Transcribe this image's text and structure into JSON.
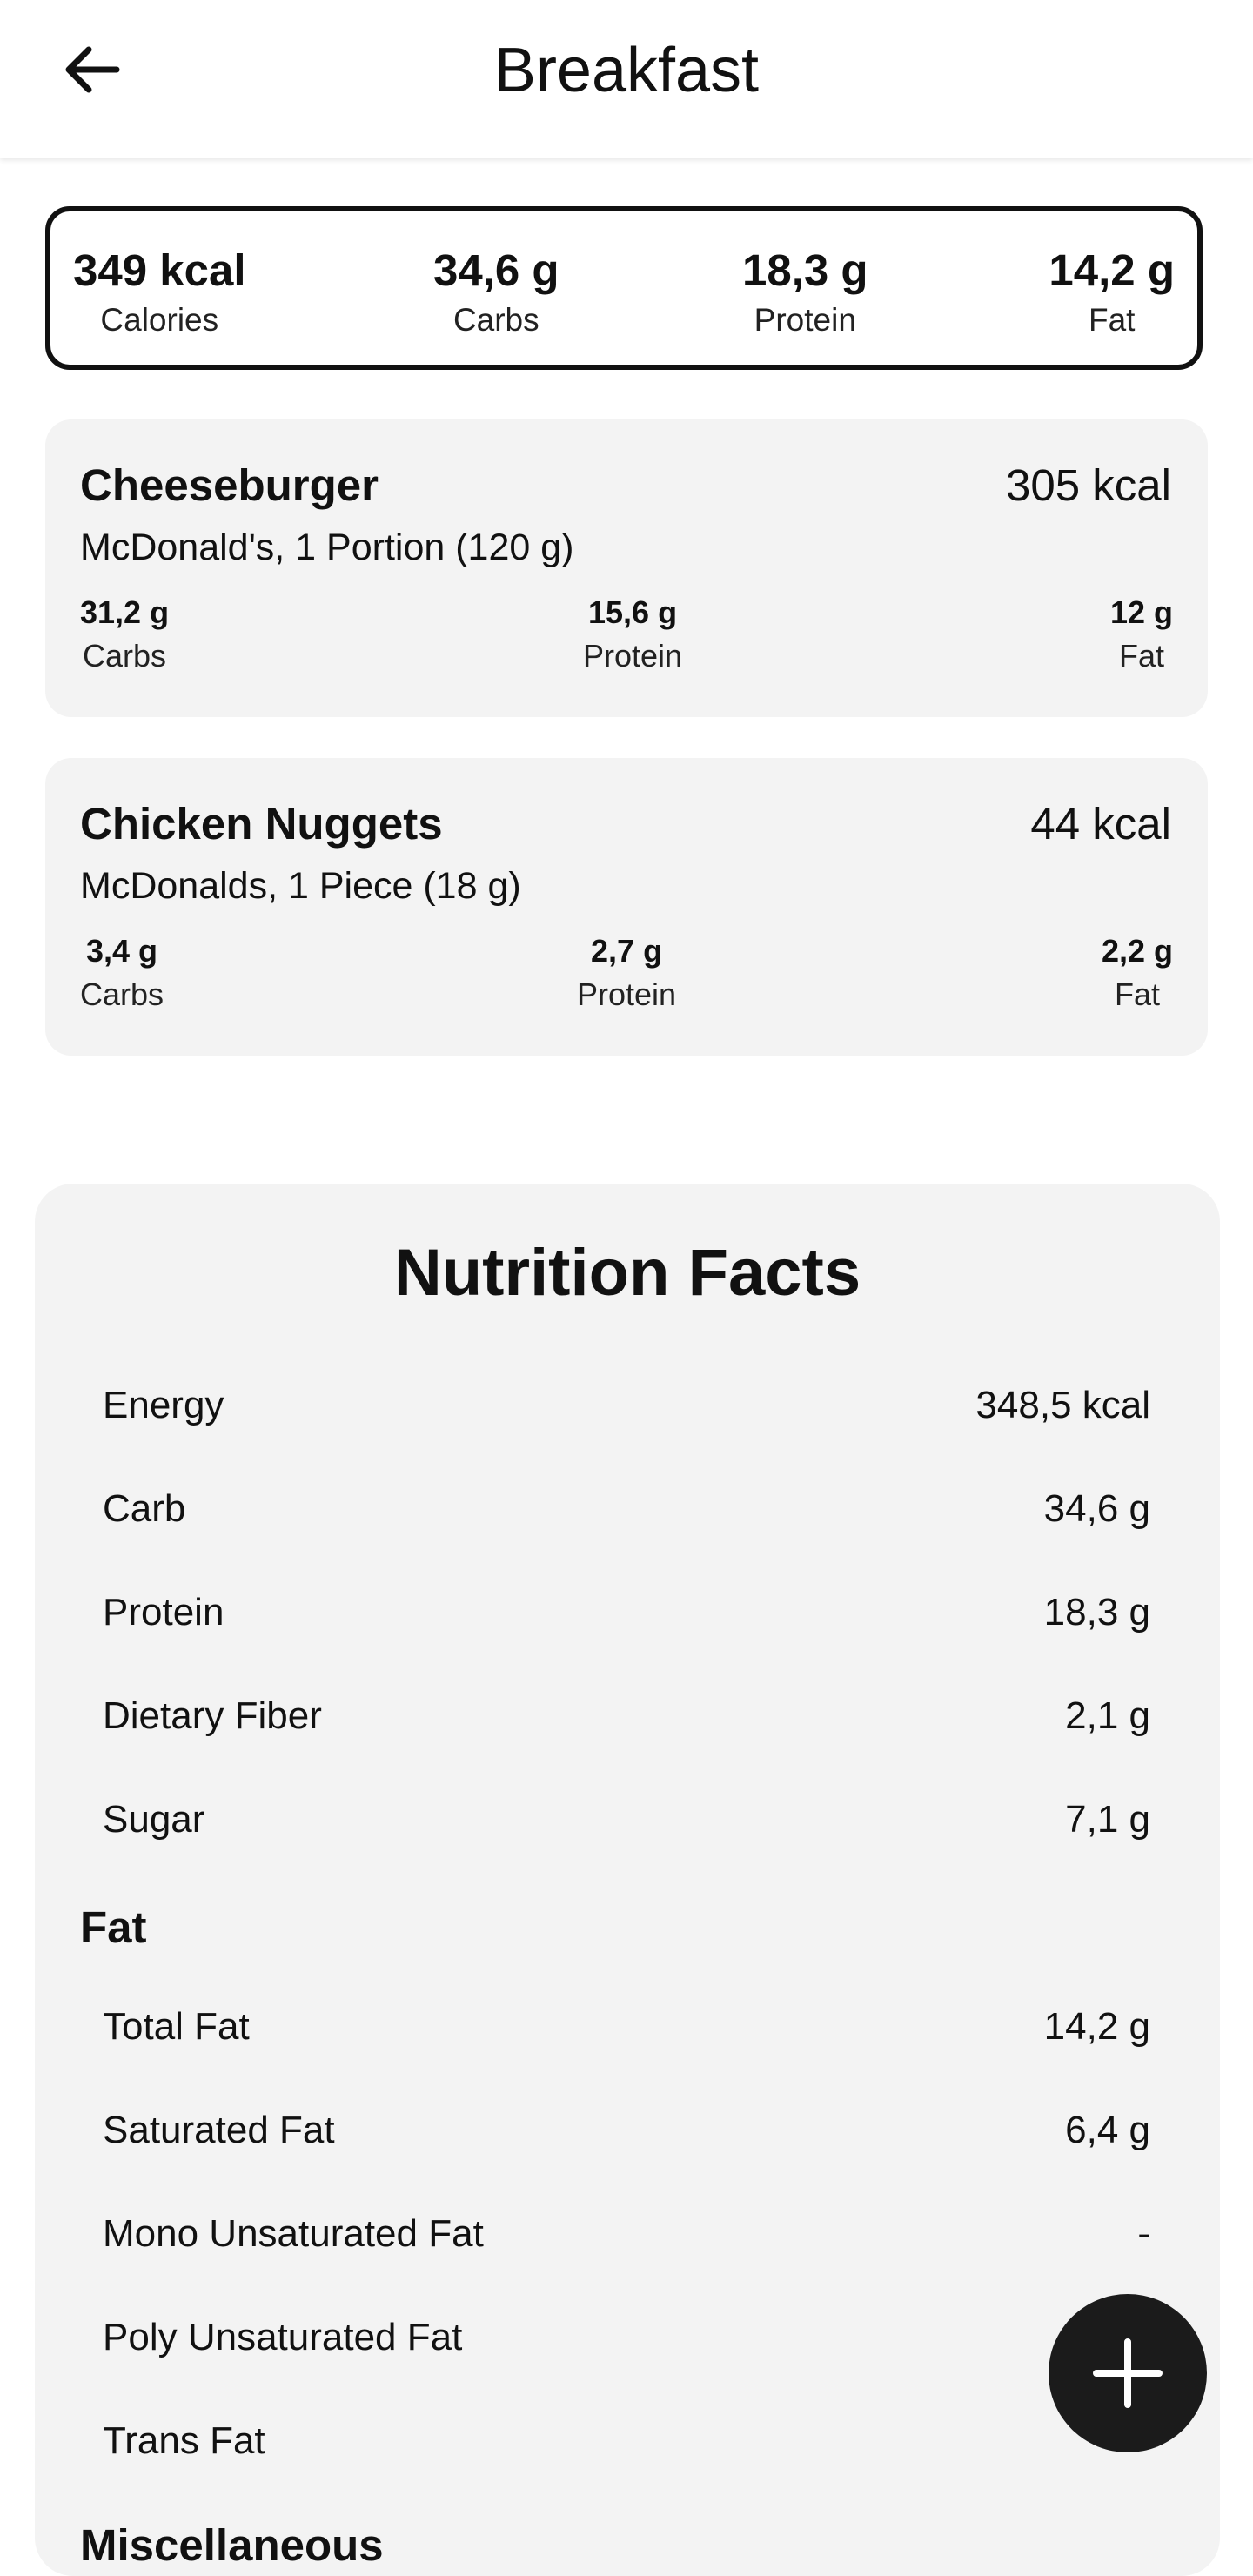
{
  "header": {
    "title": "Breakfast"
  },
  "summary": [
    {
      "value": "349 kcal",
      "label": "Calories"
    },
    {
      "value": "34,6 g",
      "label": "Carbs"
    },
    {
      "value": "18,3 g",
      "label": "Protein"
    },
    {
      "value": "14,2 g",
      "label": "Fat"
    }
  ],
  "entries": [
    {
      "name": "Cheeseburger",
      "kcal": "305 kcal",
      "detail": "McDonald's, 1 Portion (120 g)",
      "macros": [
        {
          "value": "31,2 g",
          "label": "Carbs"
        },
        {
          "value": "15,6 g",
          "label": "Protein"
        },
        {
          "value": "12 g",
          "label": "Fat"
        }
      ]
    },
    {
      "name": "Chicken Nuggets",
      "kcal": "44 kcal",
      "detail": "McDonalds, 1 Piece (18 g)",
      "macros": [
        {
          "value": "3,4 g",
          "label": "Carbs"
        },
        {
          "value": "2,7 g",
          "label": "Protein"
        },
        {
          "value": "2,2 g",
          "label": "Fat"
        }
      ]
    }
  ],
  "nutrition": {
    "title": "Nutrition Facts",
    "general": [
      {
        "label": "Energy",
        "value": "348,5 kcal"
      },
      {
        "label": "Carb",
        "value": "34,6 g"
      },
      {
        "label": "Protein",
        "value": "18,3 g"
      },
      {
        "label": "Dietary Fiber",
        "value": "2,1 g"
      },
      {
        "label": "Sugar",
        "value": "7,1 g"
      }
    ],
    "fat_heading": "Fat",
    "fat": [
      {
        "label": "Total Fat",
        "value": "14,2 g"
      },
      {
        "label": "Saturated Fat",
        "value": "6,4 g"
      },
      {
        "label": "Mono Unsaturated Fat",
        "value": "-"
      },
      {
        "label": "Poly Unsaturated Fat",
        "value": ""
      },
      {
        "label": "Trans Fat",
        "value": ""
      }
    ],
    "misc_heading": "Miscellaneous"
  },
  "icons": {
    "back": "arrow-left-icon",
    "add": "plus-icon"
  },
  "colors": {
    "card_bg": "#f3f3f3",
    "fab_bg": "#1b1b1b",
    "border": "#111111"
  }
}
